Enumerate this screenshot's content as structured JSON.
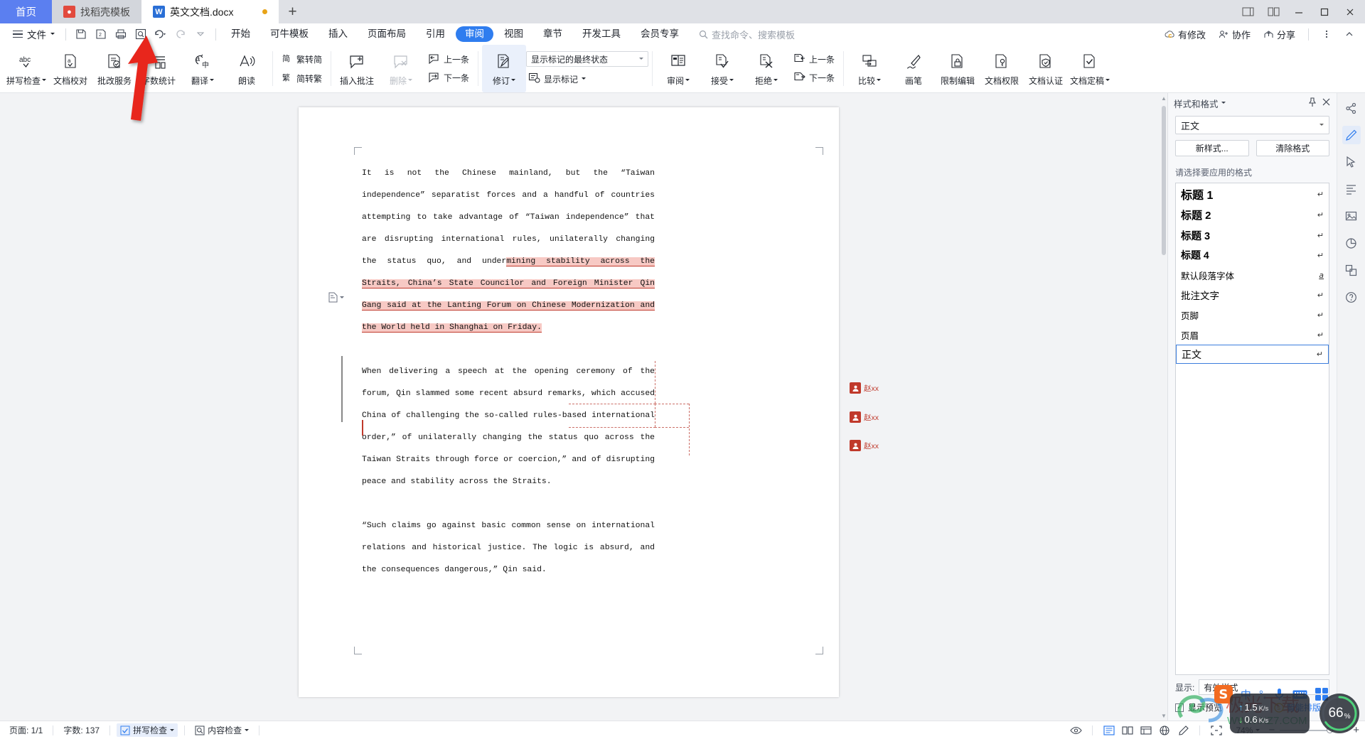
{
  "tabbar": {
    "home_label": "首页",
    "tabs": [
      {
        "label": "找稻壳模板",
        "icon": "kdocs-icon",
        "state": "inactive"
      },
      {
        "label": "英文文档.docx",
        "icon": "word-icon",
        "state": "active",
        "modified": true
      }
    ],
    "new_tab_label": "+",
    "window_controls": [
      "restore-layout-icon",
      "split-layout-icon",
      "minimize-icon",
      "maximize-icon",
      "close-icon"
    ]
  },
  "menu": {
    "file_label": "文件",
    "quick_access": [
      "save-icon",
      "save-as-icon",
      "print-icon",
      "print-preview-icon",
      "undo-icon",
      "redo-icon",
      "customize-icon"
    ],
    "tabs": [
      {
        "label": "开始",
        "selected": false
      },
      {
        "label": "可牛模板",
        "selected": false
      },
      {
        "label": "插入",
        "selected": false
      },
      {
        "label": "页面布局",
        "selected": false
      },
      {
        "label": "引用",
        "selected": false
      },
      {
        "label": "审阅",
        "selected": true
      },
      {
        "label": "视图",
        "selected": false
      },
      {
        "label": "章节",
        "selected": false
      },
      {
        "label": "开发工具",
        "selected": false
      },
      {
        "label": "会员专享",
        "selected": false
      }
    ],
    "search_placeholder": "查找命令、搜索模板",
    "right_items": [
      {
        "label": "有修改",
        "icon": "cloud-sync-icon"
      },
      {
        "label": "协作",
        "icon": "collaborate-icon"
      },
      {
        "label": "分享",
        "icon": "share-icon"
      }
    ],
    "more_icon": "more-vertical-icon",
    "collapse_icon": "chevron-up-icon"
  },
  "ribbon": {
    "groups": [
      {
        "buttons": [
          {
            "label": "拼写检查",
            "icon": "spellcheck-icon",
            "dropdown": true,
            "state": "normal"
          },
          {
            "label": "文档校对",
            "icon": "proofread-icon",
            "dropdown": false,
            "state": "normal"
          },
          {
            "label": "批改服务",
            "icon": "correction-service-icon",
            "dropdown": false,
            "state": "normal"
          },
          {
            "label": "字数统计",
            "icon": "word-count-icon",
            "dropdown": false,
            "state": "normal"
          },
          {
            "label": "翻译",
            "icon": "translate-icon",
            "dropdown": true,
            "state": "normal"
          },
          {
            "label": "朗读",
            "icon": "read-aloud-icon",
            "dropdown": false,
            "state": "normal"
          }
        ]
      },
      {
        "small_buttons": [
          {
            "label": "繁转简",
            "icon": "trad-to-simp-icon"
          },
          {
            "label": "简转繁",
            "icon": "simp-to-trad-icon"
          }
        ]
      },
      {
        "buttons": [
          {
            "label": "插入批注",
            "icon": "insert-comment-icon",
            "dropdown": false,
            "state": "normal"
          },
          {
            "label": "删除",
            "icon": "delete-comment-icon",
            "dropdown": true,
            "state": "disabled"
          }
        ],
        "small_buttons": [
          {
            "label": "上一条",
            "icon": "prev-comment-icon"
          },
          {
            "label": "下一条",
            "icon": "next-comment-icon"
          }
        ]
      },
      {
        "buttons": [
          {
            "label": "修订",
            "icon": "track-changes-icon",
            "dropdown": true,
            "state": "active"
          }
        ],
        "display_combo": "显示标记的最终状态",
        "markup_label": "显示标记",
        "markup_icon": "show-markup-icon"
      },
      {
        "buttons": [
          {
            "label": "审阅",
            "icon": "reviewing-pane-icon",
            "dropdown": true,
            "state": "normal"
          },
          {
            "label": "接受",
            "icon": "accept-icon",
            "dropdown": true,
            "state": "normal"
          },
          {
            "label": "拒绝",
            "icon": "reject-icon",
            "dropdown": true,
            "state": "normal"
          }
        ],
        "small_buttons": [
          {
            "label": "上一条",
            "icon": "prev-change-icon"
          },
          {
            "label": "下一条",
            "icon": "next-change-icon"
          }
        ]
      },
      {
        "buttons": [
          {
            "label": "比较",
            "icon": "compare-icon",
            "dropdown": true,
            "state": "normal"
          },
          {
            "label": "画笔",
            "icon": "brush-icon",
            "dropdown": false,
            "state": "normal"
          },
          {
            "label": "限制编辑",
            "icon": "restrict-edit-icon",
            "dropdown": false,
            "state": "normal"
          },
          {
            "label": "文档权限",
            "icon": "doc-permission-icon",
            "dropdown": false,
            "state": "normal"
          },
          {
            "label": "文档认证",
            "icon": "doc-certify-icon",
            "dropdown": false,
            "state": "normal"
          },
          {
            "label": "文档定稿",
            "icon": "doc-finalize-icon",
            "dropdown": true,
            "state": "normal"
          }
        ]
      }
    ]
  },
  "document": {
    "paragraph1": {
      "plain_before": "It is not the Chinese mainland, but the “Taiwan independence” separatist forces and a handful of countries attempting to take advantage of “Taiwan independence” that are disrupting international rules, unilaterally changing the status quo, and under",
      "highlighted": "mining stability across the Straits, China’s State Councilor and Foreign Minister Qin Gang said at the Lanting Forum on Chinese Modernization and the World held in Shanghai on Friday."
    },
    "paragraph2": "When delivering a speech at the opening ceremony of the forum, Qin slammed some recent absurd remarks, which accused China of challenging the so-called rules-based international order,” of unilaterally changing the status quo across the Taiwan Straits through force or coercion,” and of disrupting peace and stability across the Straits.",
    "paragraph3": "“Such claims go against basic common sense on international relations and historical justice. The logic is absurd, and the consequences dangerous,” Qin said.",
    "comments": [
      {
        "author": "赵xx",
        "avatar": "user-avatar-icon"
      },
      {
        "author": "赵xx",
        "avatar": "user-avatar-icon"
      },
      {
        "author": "赵xx",
        "avatar": "user-avatar-icon"
      }
    ]
  },
  "style_panel": {
    "title": "样式和格式",
    "pin_icon": "pin-icon",
    "close_icon": "close-icon",
    "current_style": "正文",
    "new_style_label": "新样式...",
    "clear_format_label": "清除格式",
    "hint": "请选择要应用的格式",
    "items": [
      {
        "label": "标题 1",
        "mark": "↵",
        "selected": false
      },
      {
        "label": "标题 2",
        "mark": "↵",
        "selected": false
      },
      {
        "label": "标题 3",
        "mark": "↵",
        "selected": false
      },
      {
        "label": "标题 4",
        "mark": "↵",
        "selected": false
      },
      {
        "label": "默认段落字体",
        "mark": "a",
        "selected": false
      },
      {
        "label": "批注文字",
        "mark": "↵",
        "selected": false
      },
      {
        "label": "页脚",
        "mark": "↵",
        "selected": false
      },
      {
        "label": "页眉",
        "mark": "↵",
        "selected": false
      },
      {
        "label": "正文",
        "mark": "↵",
        "selected": true
      }
    ],
    "show_label": "显示:",
    "show_value": "有效样式",
    "preview_label": "显示预览",
    "preview_checked": true
  },
  "rail": {
    "items": [
      {
        "icon": "share-doc-icon",
        "active": false
      },
      {
        "icon": "edit-pen-icon",
        "active": true
      },
      {
        "icon": "cursor-select-icon",
        "active": false
      },
      {
        "icon": "paragraph-layout-icon",
        "active": false
      },
      {
        "icon": "image-icon",
        "active": false
      },
      {
        "icon": "chart-icon",
        "active": false
      },
      {
        "icon": "screenshot-icon",
        "active": false
      },
      {
        "icon": "help-icon",
        "active": false
      }
    ]
  },
  "status_bar": {
    "page_label": "页面: 1/1",
    "word_count_label": "字数: 137",
    "spellcheck_label": "拼写检查",
    "content_check_label": "内容检查",
    "view_icons": [
      "eye-icon",
      "print-layout-icon",
      "full-screen-read-icon",
      "web-layout-icon",
      "outline-icon",
      "edit-mode-icon",
      "focus-icon"
    ],
    "zoom_level": "74%",
    "zoom_minus": "−",
    "zoom_plus": "+"
  },
  "overlays": {
    "ime": {
      "logo": "sogou-icon",
      "mode": "中",
      "punct_icon": "punctuation-icon",
      "mic_icon": "microphone-icon",
      "keyboard_icon": "keyboard-icon",
      "apps_icon": "apps-grid-icon"
    },
    "smart_layout": "智能排版",
    "net_up": "1.5",
    "net_up_unit": "K/s",
    "net_down": "0.6",
    "net_down_unit": "K/s",
    "cpu": "66",
    "cpu_unit": "%"
  },
  "colors": {
    "accent": "#2f7def",
    "home_tab": "#5b7ff0",
    "highlight": "#f7c9c4",
    "revision": "#c0392b"
  }
}
